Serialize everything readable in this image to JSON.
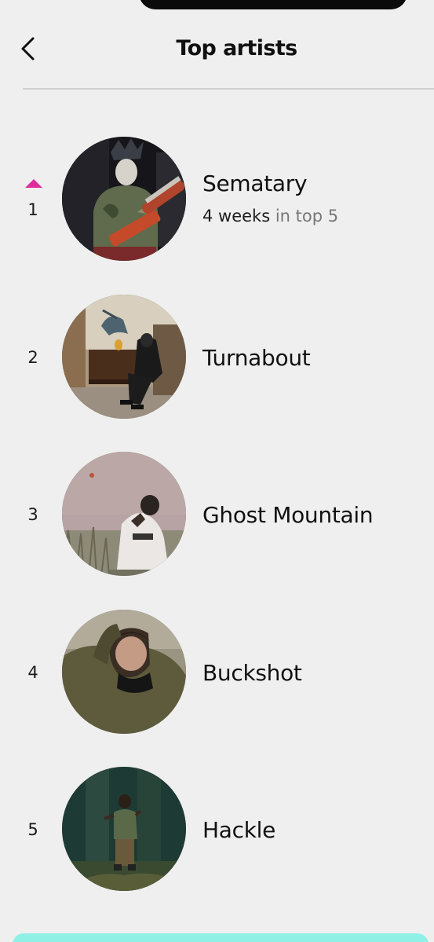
{
  "header": {
    "title": "Top artists",
    "back_icon": "chevron-left-icon"
  },
  "artists": [
    {
      "rank": "1",
      "name": "Sematary",
      "trend": "up",
      "weeks": "4 weeks",
      "in_top": "in top 5"
    },
    {
      "rank": "2",
      "name": "Turnabout"
    },
    {
      "rank": "3",
      "name": "Ghost Mountain"
    },
    {
      "rank": "4",
      "name": "Buckshot"
    },
    {
      "rank": "5",
      "name": "Hackle"
    }
  ],
  "colors": {
    "background": "#efefef",
    "trend_up": "#de2d9d",
    "bottom_bar": "#8ff0e6"
  }
}
